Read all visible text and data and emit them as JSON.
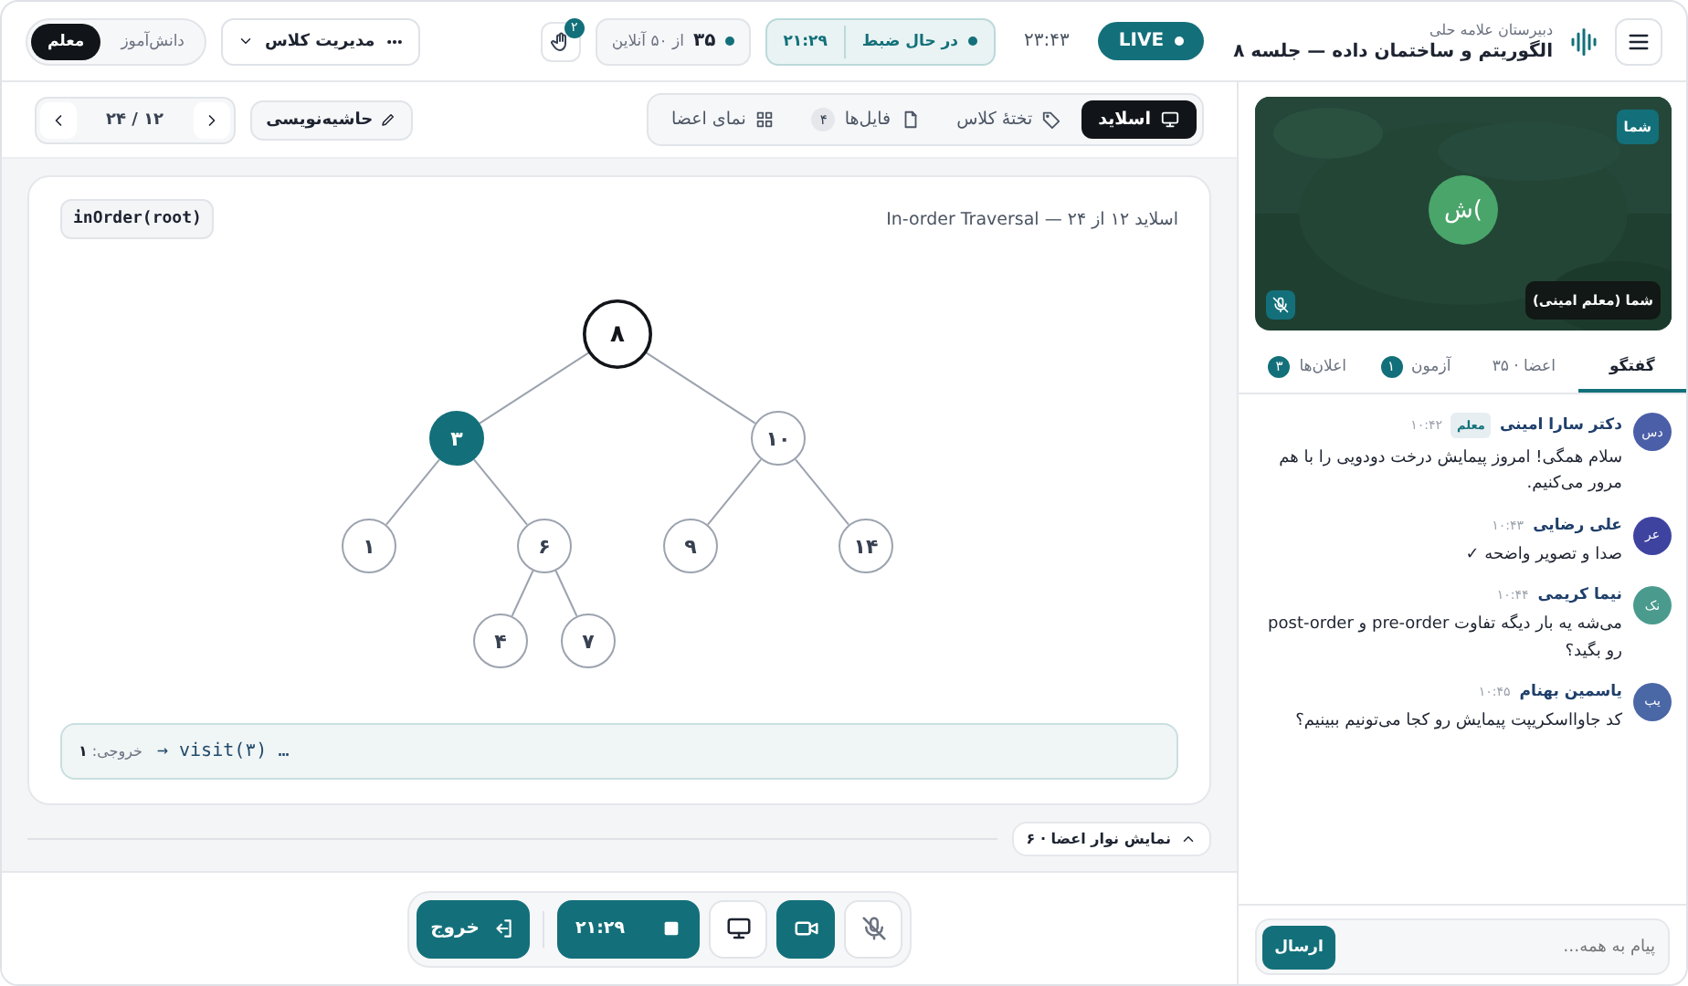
{
  "header": {
    "subtitle": "دبیرستان علامه حلی",
    "title": "الگوریتم و ساختمان داده — جلسه ۸",
    "live": "LIVE",
    "clock": "۲۳:۴۳",
    "recording": {
      "label": "در حال ضبط",
      "time": "۲۱:۲۹"
    },
    "online": {
      "count": "۳۵",
      "rest": "از ۵۰ آنلاین"
    },
    "hand_badge": "۲",
    "manage": "مدیریت کلاس",
    "roles": [
      {
        "label": "دانش‌آموز",
        "selected": false
      },
      {
        "label": "معلم",
        "selected": true
      }
    ]
  },
  "toolbar": {
    "tabs": [
      {
        "label": "اسلاید",
        "selected": true
      },
      {
        "label": "تختهٔ کلاس",
        "selected": false
      },
      {
        "label": "فایل‌ها",
        "badge": "۴",
        "selected": false
      },
      {
        "label": "نمای اعضا",
        "selected": false
      }
    ],
    "annotate": "حاشیه‌نویسی",
    "pager": "۱۲ / ۲۴"
  },
  "slide": {
    "caption": "اسلاید ۱۲ از ۲۴ — In-order Traversal",
    "code": "inOrder(root)",
    "tree": {
      "label": "۸",
      "kind": "visiting",
      "children": [
        {
          "label": "۱۰",
          "kind": "default",
          "children": [
            {
              "label": "۱۴",
              "kind": "default"
            },
            {
              "label": "۹",
              "kind": "default"
            }
          ]
        },
        {
          "label": "۳",
          "kind": "current",
          "children": [
            {
              "label": "۶",
              "kind": "default",
              "children": [
                {
                  "label": "۷",
                  "kind": "default"
                },
                {
                  "label": "۴",
                  "kind": "default"
                }
              ]
            },
            {
              "label": "۱",
              "kind": "default"
            }
          ]
        }
      ]
    },
    "output": {
      "text": "خروجی: **۱**",
      "trace": "→ visit(۳) …"
    }
  },
  "members_toggle": {
    "label": "نمایش نوار اعضا · ۶",
    "expanded": false
  },
  "controls": [
    {
      "kind": "mic",
      "on": false
    },
    {
      "kind": "camera",
      "on": true
    },
    {
      "kind": "screen",
      "on": false
    },
    {
      "kind": "record",
      "on": true,
      "label": "۲۱:۲۹"
    },
    {
      "kind": "exit",
      "label": "خروج"
    }
  ],
  "sidebar": {
    "video": {
      "badge": "شما",
      "initials": "ش(",
      "name": "شما (معلم امینی)",
      "muted": true
    },
    "tabs": [
      {
        "label": "گفتگو",
        "selected": true
      },
      {
        "label": "اعضا · ۳۵",
        "selected": false
      },
      {
        "label": "آزمون",
        "badge": "۱",
        "selected": false
      },
      {
        "label": "اعلان‌ها",
        "badge": "۳",
        "selected": false
      }
    ],
    "messages": [
      {
        "initials": "دس",
        "color": "#4b5ea8",
        "name": "دکتر سارا امینی",
        "role": "معلم",
        "time": "۱۰:۴۲",
        "text": "سلام همگی! امروز پیمایش درخت دودویی را با هم مرور می‌کنیم."
      },
      {
        "initials": "عر",
        "color": "#3f43a0",
        "name": "علی رضایی",
        "time": "۱۰:۴۳",
        "text": "صدا و تصویر واضحه ✓"
      },
      {
        "initials": "نک",
        "color": "#4a9b8e",
        "name": "نیما کریمی",
        "time": "۱۰:۴۴",
        "text": "می‌شه یه بار دیگه تفاوت pre-order و post-order رو بگید؟"
      },
      {
        "initials": "یب",
        "color": "#4a67a6",
        "name": "یاسمین بهنام",
        "time": "۱۰:۴۵",
        "text": "کد جاوااسکریپت پیمایش رو کجا می‌تونیم ببینیم؟"
      }
    ],
    "composer": {
      "placeholder": "پیام به همه…",
      "send": "ارسال"
    }
  }
}
